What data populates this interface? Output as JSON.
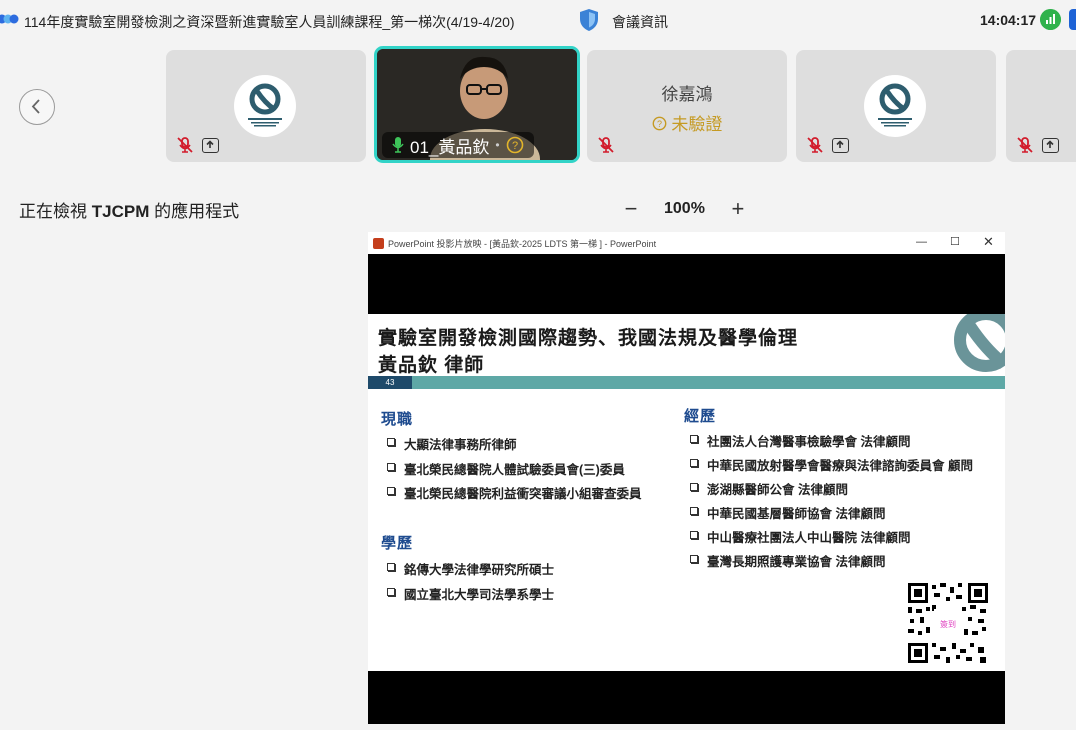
{
  "topbar": {
    "title": "114年度實驗室開發檢測之資深暨新進實驗室人員訓練課程_第一梯次(4/19-4/20)",
    "meeting_info_label": "會議資訊",
    "clock": "14:04:17"
  },
  "participants": [
    {
      "name": "",
      "muted": true,
      "sharing_icon": true,
      "avatar": "logo"
    },
    {
      "name": "01_黃品欽",
      "active": true,
      "mic_on": true
    },
    {
      "name": "徐嘉鴻",
      "status": "未驗證",
      "muted": true
    },
    {
      "name": "",
      "muted": true,
      "sharing_icon": true,
      "avatar": "logo"
    },
    {
      "name": "",
      "muted": true,
      "sharing_icon": true,
      "avatar": "logo"
    }
  ],
  "share": {
    "viewing_prefix": "正在檢視 ",
    "viewing_app": "TJCPM",
    "viewing_suffix": " 的應用程式",
    "zoom_level": "100%"
  },
  "ppt": {
    "window_title": "PowerPoint 投影片放映 - [黃品欽-2025 LDTS 第一梯 ] - PowerPoint",
    "slide_number": "43",
    "title_line1": "實驗室開發檢測國際趨勢、我國法規及醫學倫理",
    "title_line2": "黃品欽 律師",
    "current_heading": "現職",
    "current_items": [
      "大顯法律事務所律師",
      "臺北榮民總醫院人體試驗委員會(三)委員",
      "臺北榮民總醫院利益衝突審議小組審查委員"
    ],
    "edu_heading": "學歷",
    "edu_items": [
      "銘傳大學法律學研究所碩士",
      "國立臺北大學司法學系學士"
    ],
    "exp_heading": "經歷",
    "exp_items": [
      "社團法人台灣醫事檢驗學會 法律顧問",
      "中華民國放射醫學會醫療與法律諮詢委員會 顧問",
      "澎湖縣醫師公會 法律顧問",
      "中華民國基層醫師協會 法律顧問",
      "中山醫療社團法人中山醫院 法律顧問",
      "臺灣長期照護專業協會 法律顧問"
    ],
    "qr_label": "簽到"
  },
  "colors": {
    "accent_teal": "#32d3c7",
    "slide_bar": "#5ea8a6",
    "slide_number_bg": "#1e4a6a",
    "heading_blue": "#1e4b8f",
    "unverified": "#c59a23"
  }
}
